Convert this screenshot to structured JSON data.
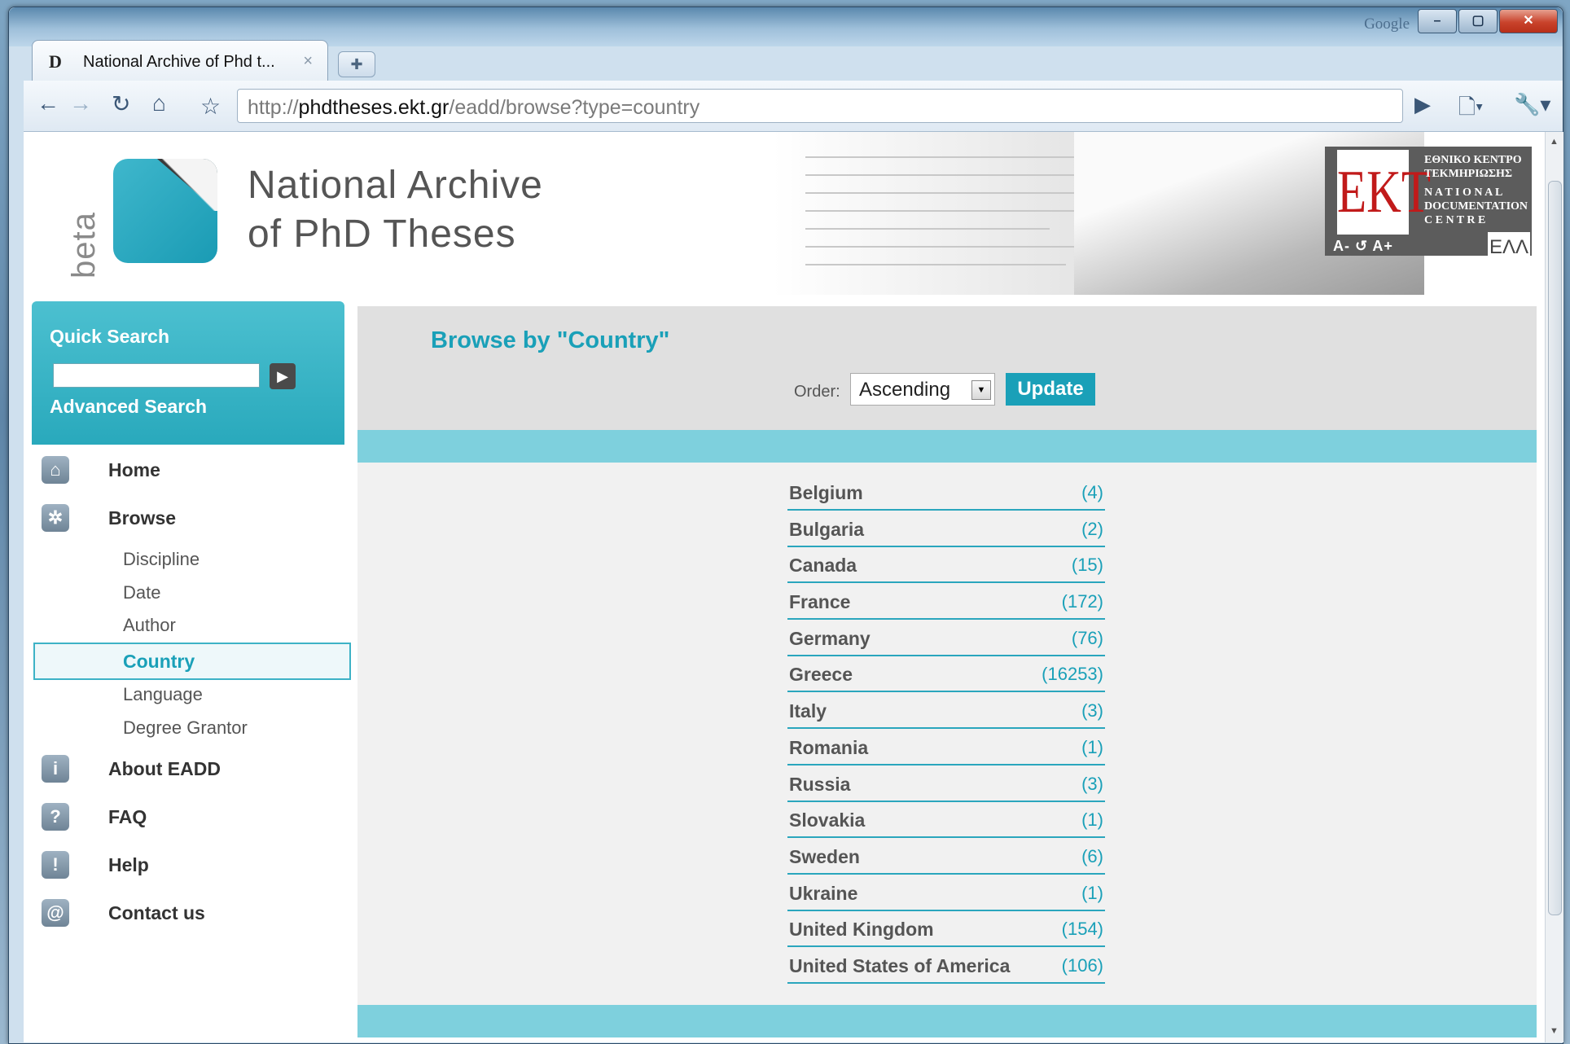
{
  "browser": {
    "tab_title": "National Archive of Phd t...",
    "tab_favicon": "D",
    "tab_close": "×",
    "new_tab_icon": "✚",
    "url_prefix": "http://",
    "url_host": "phdtheses.ekt.gr",
    "url_path": "/eadd/browse?type=country",
    "search_engine_label": "Google"
  },
  "header": {
    "beta": "beta",
    "title_line1": "National Archive",
    "title_line2": "of PhD Theses",
    "ekt_logo": "EKT",
    "ekt_greek_line1": "ΕΘΝΙΚΟ ΚΕΝΤΡΟ",
    "ekt_greek_line2": "ΤΕΚΜΗΡΙΩΣΗΣ",
    "ekt_en_line1": "N A T I O N A L",
    "ekt_en_line2": "DOCUMENTATION",
    "ekt_en_line3": "C E N T R E",
    "font_tools": "A-  ↺  A+",
    "language": "ΕΛΛ"
  },
  "sidebar": {
    "quick_search_label": "Quick Search",
    "advanced_search_label": "Advanced Search",
    "nav": [
      {
        "label": "Home",
        "icon": "home-icon"
      },
      {
        "label": "Browse",
        "icon": "browse-icon"
      },
      {
        "label": "About EADD",
        "icon": "info-icon"
      },
      {
        "label": "FAQ",
        "icon": "question-icon"
      },
      {
        "label": "Help",
        "icon": "exclamation-icon"
      },
      {
        "label": "Contact us",
        "icon": "at-icon"
      }
    ],
    "browse_sub": [
      "Discipline",
      "Date",
      "Author",
      "Country",
      "Language",
      "Degree Grantor"
    ],
    "active_sub": "Country"
  },
  "main": {
    "title": "Browse by \"Country\"",
    "order_label": "Order:",
    "order_value": "Ascending",
    "update_label": "Update",
    "countries": [
      {
        "name": "Belgium",
        "count": "(4)"
      },
      {
        "name": "Bulgaria",
        "count": "(2)"
      },
      {
        "name": "Canada",
        "count": "(15)"
      },
      {
        "name": "France",
        "count": "(172)"
      },
      {
        "name": "Germany",
        "count": "(76)"
      },
      {
        "name": "Greece",
        "count": "(16253)"
      },
      {
        "name": "Italy",
        "count": "(3)"
      },
      {
        "name": "Romania",
        "count": "(1)"
      },
      {
        "name": "Russia",
        "count": "(3)"
      },
      {
        "name": "Slovakia",
        "count": "(1)"
      },
      {
        "name": "Sweden",
        "count": "(6)"
      },
      {
        "name": "Ukraine",
        "count": "(1)"
      },
      {
        "name": "United Kingdom",
        "count": "(154)"
      },
      {
        "name": "United States of America",
        "count": "(106)"
      }
    ]
  },
  "colors": {
    "accent": "#1aa0b8",
    "band": "#7ed0dd",
    "ekt_red": "#c11a1a"
  }
}
